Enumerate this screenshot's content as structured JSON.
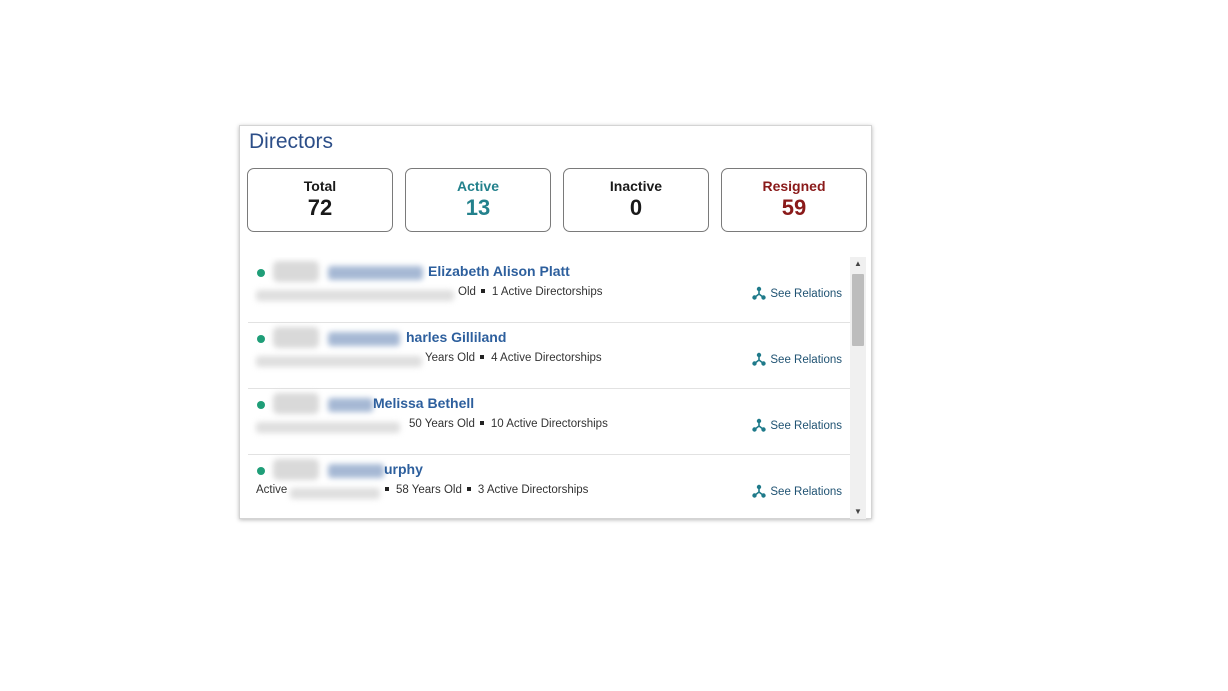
{
  "panel": {
    "title": "Directors"
  },
  "stats": [
    {
      "label": "Total",
      "value": "72",
      "color": "#1a1a1a"
    },
    {
      "label": "Active",
      "value": "13",
      "color": "#23818c"
    },
    {
      "label": "Inactive",
      "value": "0",
      "color": "#1a1a1a"
    },
    {
      "label": "Resigned",
      "value": "59",
      "color": "#8a1a1a"
    }
  ],
  "directors": [
    {
      "name": "Elizabeth Alison Platt",
      "age": "Old",
      "directorships": "1 Active Directorships",
      "relations_label": "See Relations"
    },
    {
      "name": "harles Gilliland",
      "age": "Years Old",
      "directorships": "4 Active Directorships",
      "relations_label": "See Relations"
    },
    {
      "name": "Melissa Bethell",
      "age": "50 Years Old",
      "directorships": "10 Active Directorships",
      "relations_label": "See Relations"
    },
    {
      "name": "urphy",
      "status": "Active",
      "age": "58 Years Old",
      "directorships": "3 Active Directorships",
      "relations_label": "See Relations"
    }
  ],
  "icons": {
    "status": "status-dot-icon",
    "relations": "relations-network-icon",
    "scroll_up": "scroll-up-arrow-icon",
    "scroll_down": "scroll-down-arrow-icon"
  }
}
